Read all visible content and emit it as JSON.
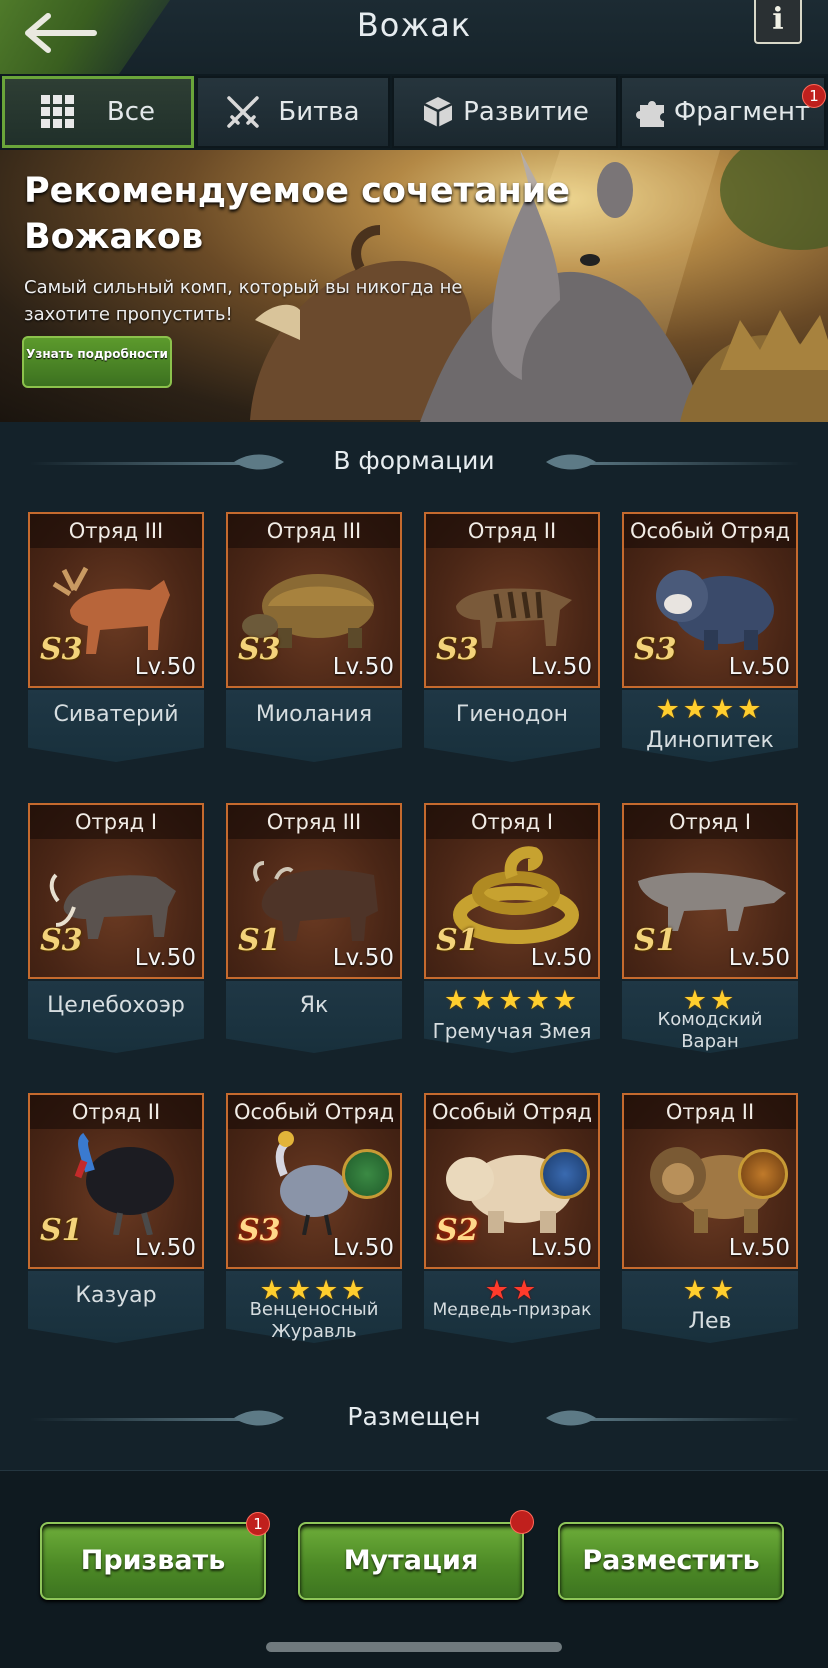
{
  "header": {
    "title": "Вожак",
    "info_label": "i"
  },
  "tabs": [
    {
      "label": "Все",
      "icon": "grid-icon",
      "active": true
    },
    {
      "label": "Битва",
      "icon": "crossed-swords-icon"
    },
    {
      "label": "Развитие",
      "icon": "cube-icon"
    },
    {
      "label": "Фрагмент",
      "icon": "puzzle-icon",
      "badge": "1"
    }
  ],
  "banner": {
    "title": "Рекомендуемое сочетание Вожаков",
    "subtitle": "Самый сильный комп, который вы никогда не захотите пропустить!",
    "button": "Узнать подробности"
  },
  "sections": {
    "in_formation": "В формации",
    "placed": "Размещен"
  },
  "cards": [
    {
      "squad": "Отряд III",
      "rank": "S3",
      "level": "Lv.50",
      "name": "Сиватерий",
      "stars": 0,
      "star_color": "yellow",
      "emblem": null
    },
    {
      "squad": "Отряд III",
      "rank": "S3",
      "level": "Lv.50",
      "name": "Миолания",
      "stars": 0,
      "star_color": "yellow",
      "emblem": null
    },
    {
      "squad": "Отряд II",
      "rank": "S3",
      "level": "Lv.50",
      "name": "Гиенодон",
      "stars": 0,
      "star_color": "yellow",
      "emblem": null
    },
    {
      "squad": "Особый Отряд",
      "rank": "S3",
      "level": "Lv.50",
      "name": "Динопитек",
      "stars": 4,
      "star_color": "yellow",
      "emblem": null
    },
    {
      "squad": "Отряд I",
      "rank": "S3",
      "level": "Lv.50",
      "name": "Целебохоэр",
      "stars": 0,
      "star_color": "yellow",
      "emblem": null
    },
    {
      "squad": "Отряд III",
      "rank": "S1",
      "level": "Lv.50",
      "name": "Як",
      "stars": 0,
      "star_color": "yellow",
      "emblem": null
    },
    {
      "squad": "Отряд I",
      "rank": "S1",
      "level": "Lv.50",
      "name": "Гремучая Змея",
      "stars": 5,
      "star_color": "yellow",
      "emblem": null
    },
    {
      "squad": "Отряд I",
      "rank": "S1",
      "level": "Lv.50",
      "name": "Комодский Варан",
      "stars": 2,
      "star_color": "yellow",
      "emblem": null
    },
    {
      "squad": "Отряд II",
      "rank": "S1",
      "level": "Lv.50",
      "name": "Казуар",
      "stars": 0,
      "star_color": "yellow",
      "emblem": null
    },
    {
      "squad": "Особый Отряд",
      "rank": "S3",
      "level": "Lv.50",
      "name": "Венценосный Журавль",
      "stars": 4,
      "star_color": "yellow",
      "emblem": "green-leaf-emblem"
    },
    {
      "squad": "Особый Отряд",
      "rank": "S2",
      "level": "Lv.50",
      "name": "Медведь-призрак",
      "stars": 2,
      "star_color": "red",
      "emblem": "blue-bird-emblem"
    },
    {
      "squad": "Отряд II",
      "rank": "",
      "level": "Lv.50",
      "name": "Лев",
      "stars": 2,
      "star_color": "yellow",
      "emblem": "dragon-emblem"
    }
  ],
  "buttons": [
    {
      "label": "Призвать",
      "badge": "1"
    },
    {
      "label": "Мутация",
      "badge_dot": true
    },
    {
      "label": "Разместить"
    }
  ]
}
